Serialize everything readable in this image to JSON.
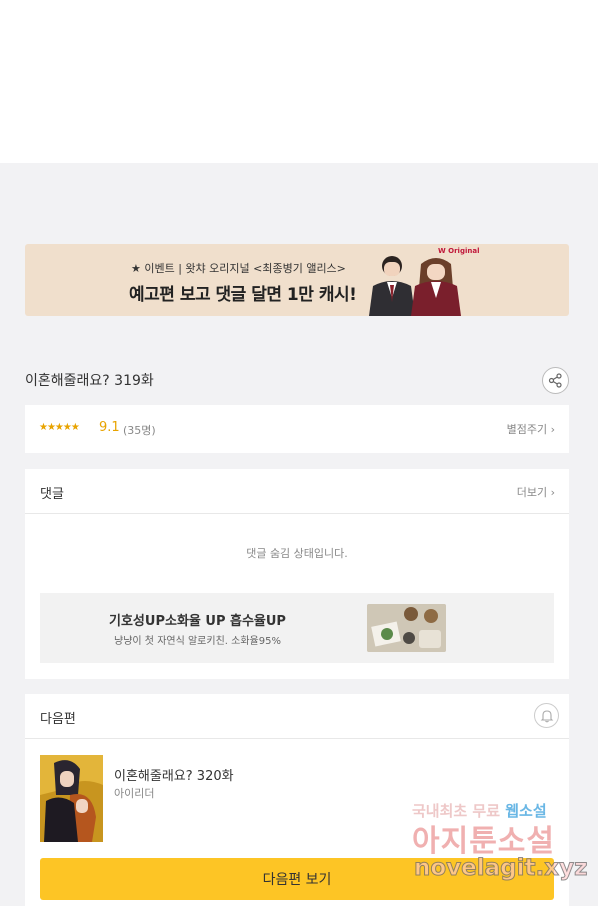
{
  "banner": {
    "small_text": "★ 이벤트 | 왓챠 오리지널 <최종병기 앨리스>",
    "big_text": "예고편 보고 댓글 달면 1만 캐시!",
    "logo_text": "W Original"
  },
  "episode": {
    "title": "이혼해줄래요? 319화"
  },
  "rating": {
    "stars": "★★★★★",
    "score": "9.1",
    "count": "(35명)",
    "rate_label": "별점주기 ›"
  },
  "comments": {
    "title": "댓글",
    "more_label": "더보기 ›",
    "hidden_message": "댓글 숨김 상태입니다."
  },
  "ad": {
    "title": "기호성UP소화율 UP 흡수율UP",
    "subtitle": "냥냥이 첫 자연식 알로키친. 소화율95%"
  },
  "next": {
    "title": "다음편",
    "episode_title": "이혼해줄래요? 320화",
    "author": "아이리더",
    "button_label": "다음편 보기"
  },
  "watermark": {
    "line1_a": "국내최초 무료 ",
    "line1_b": "웹소설",
    "line2": "아지툰소설",
    "line3": "novelagit.xyz"
  },
  "colors": {
    "accent_yellow": "#fdc525",
    "star_color": "#e8a300",
    "banner_bg": "#f0dfcc",
    "page_bg": "#f2f2f4"
  }
}
